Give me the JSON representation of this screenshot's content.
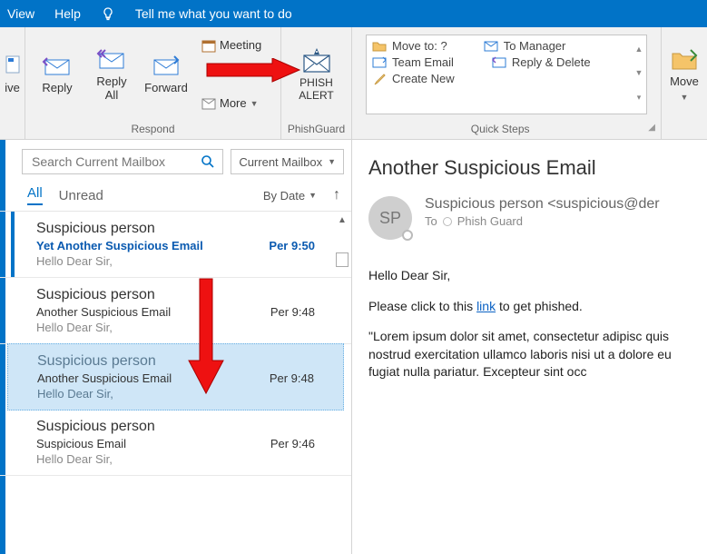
{
  "menubar": {
    "view": "View",
    "help": "Help",
    "tellme": "Tell me what you want to do"
  },
  "ribbon": {
    "left_partial": "ive",
    "respond": {
      "reply": "Reply",
      "replyall": "Reply\nAll",
      "forward": "Forward",
      "meeting": "Meeting",
      "more": "More",
      "label": "Respond"
    },
    "phish": {
      "button": "PHISH\nALERT",
      "label": "PhishGuard"
    },
    "quicksteps": {
      "moveto": "Move to: ?",
      "teamemail": "Team Email",
      "createnew": "Create New",
      "tomanager": "To Manager",
      "replydelete": "Reply & Delete",
      "label": "Quick Steps"
    },
    "right_partial": "Move"
  },
  "list": {
    "search_placeholder": "Search Current Mailbox",
    "scope": "Current Mailbox",
    "filter_all": "All",
    "filter_unread": "Unread",
    "bydate": "By Date",
    "messages": [
      {
        "from": "Suspicious person",
        "subject": "Yet Another Suspicious Email",
        "preview": "Hello Dear Sir,",
        "time": "Per 9:50",
        "unread": true,
        "selected": false
      },
      {
        "from": "Suspicious person",
        "subject": "Another Suspicious Email",
        "preview": "Hello Dear Sir,",
        "time": "Per 9:48",
        "unread": false,
        "selected": false
      },
      {
        "from": "Suspicious person",
        "subject": "Another Suspicious Email",
        "preview": "Hello Dear Sir,",
        "time": "Per 9:48",
        "unread": false,
        "selected": true
      },
      {
        "from": "Suspicious person",
        "subject": "Suspicious Email",
        "preview": "Hello Dear Sir,",
        "time": "Per 9:46",
        "unread": false,
        "selected": false
      }
    ]
  },
  "reading": {
    "subject": "Another Suspicious Email",
    "initials": "SP",
    "from": "Suspicious person <suspicious@der",
    "to_label": "To",
    "to": "Phish Guard",
    "body_p1": "Hello Dear Sir,",
    "body_p2a": "Please click to this ",
    "body_link": "link",
    "body_p2b": " to get phished.",
    "body_p3": "\"Lorem ipsum dolor sit amet, consectetur adipisc quis nostrud exercitation ullamco laboris nisi ut a dolore eu fugiat nulla pariatur. Excepteur sint occ"
  }
}
